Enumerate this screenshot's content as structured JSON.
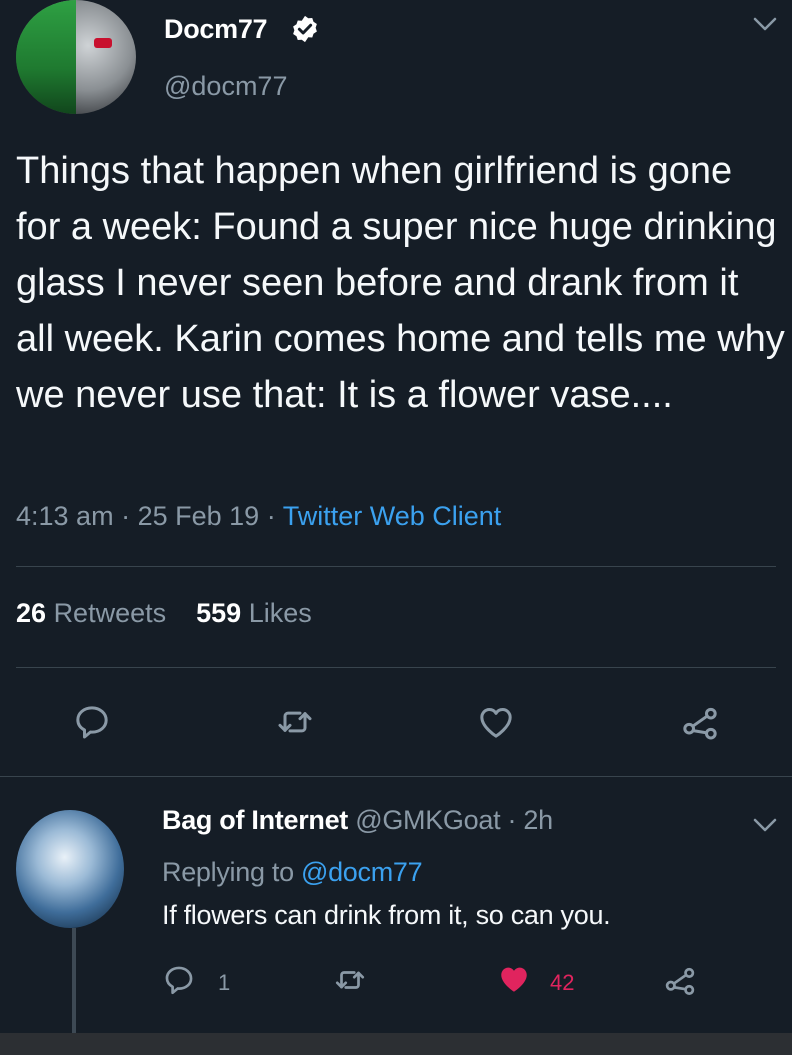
{
  "colors": {
    "background": "#151d26",
    "secondary_text": "#8a99a6",
    "link": "#3ba1ef",
    "like_active": "#e0245e",
    "divider": "#38444d"
  },
  "tweet": {
    "author_name": "Docm77",
    "author_handle": "@docm77",
    "verified": true,
    "text": "Things that happen when girlfriend is gone for a week: Found a super nice huge drinking glass I never seen before and drank from it all week. Karin comes home and tells me why we never use that: It is a flower vase....",
    "time": "4:13 am",
    "date": "25 Feb 19",
    "separator": "·",
    "client": "Twitter Web Client",
    "retweet_count": "26",
    "retweet_label": "Retweets",
    "like_count": "559",
    "like_label": "Likes"
  },
  "icons": {
    "reply": "reply-icon",
    "retweet": "retweet-icon",
    "like": "heart-icon",
    "share": "share-icon",
    "caret": "chevron-down-icon",
    "verified": "verified-badge-icon"
  },
  "reply": {
    "author_name": "Bag of Internet",
    "author_handle": "@GMKGoat",
    "age": "· 2h",
    "replying_prefix": "Replying to",
    "replying_handle": "@docm77",
    "text": "If flowers can drink from it, so can you.",
    "reply_count": "1",
    "like_count": "42",
    "liked": true
  }
}
